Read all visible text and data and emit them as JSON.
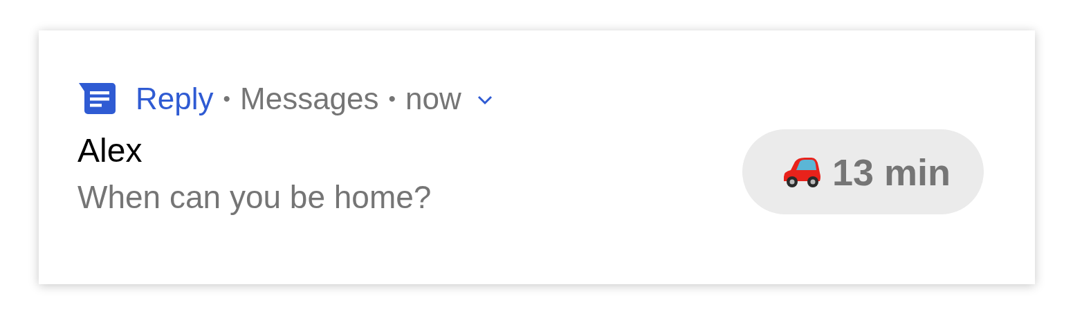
{
  "notification": {
    "app_name": "Reply",
    "separator_1": "•",
    "channel": "Messages",
    "separator_2": "•",
    "time": "now",
    "title": "Alex",
    "message": "When can you be home?",
    "chip": {
      "label": "13 min"
    }
  }
}
